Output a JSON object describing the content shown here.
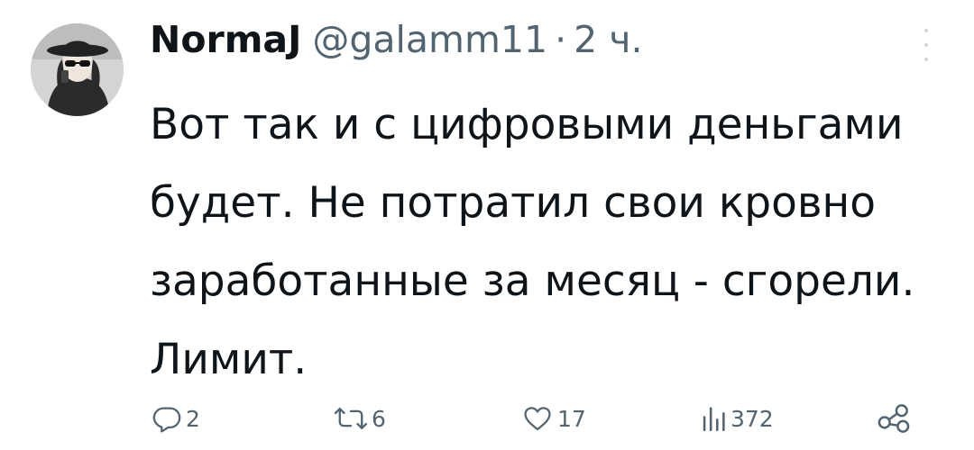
{
  "tweet": {
    "author_name": "NormaJ",
    "handle": "@galamm11",
    "separator": "·",
    "time": "2 ч.",
    "text": "Вот так и с цифровыми деньгами будет. Не потратил свои кровно заработанные за месяц - сгорели. Лимит."
  },
  "actions": {
    "replies": "2",
    "retweets": "6",
    "likes": "17",
    "views": "372"
  },
  "icons": {
    "reply": "reply-icon",
    "retweet": "retweet-icon",
    "like": "heart-icon",
    "views": "views-bars-icon",
    "share": "share-icon",
    "more": "more-dots-icon"
  },
  "colors": {
    "text_primary": "#0f1419",
    "text_secondary": "#536471"
  }
}
